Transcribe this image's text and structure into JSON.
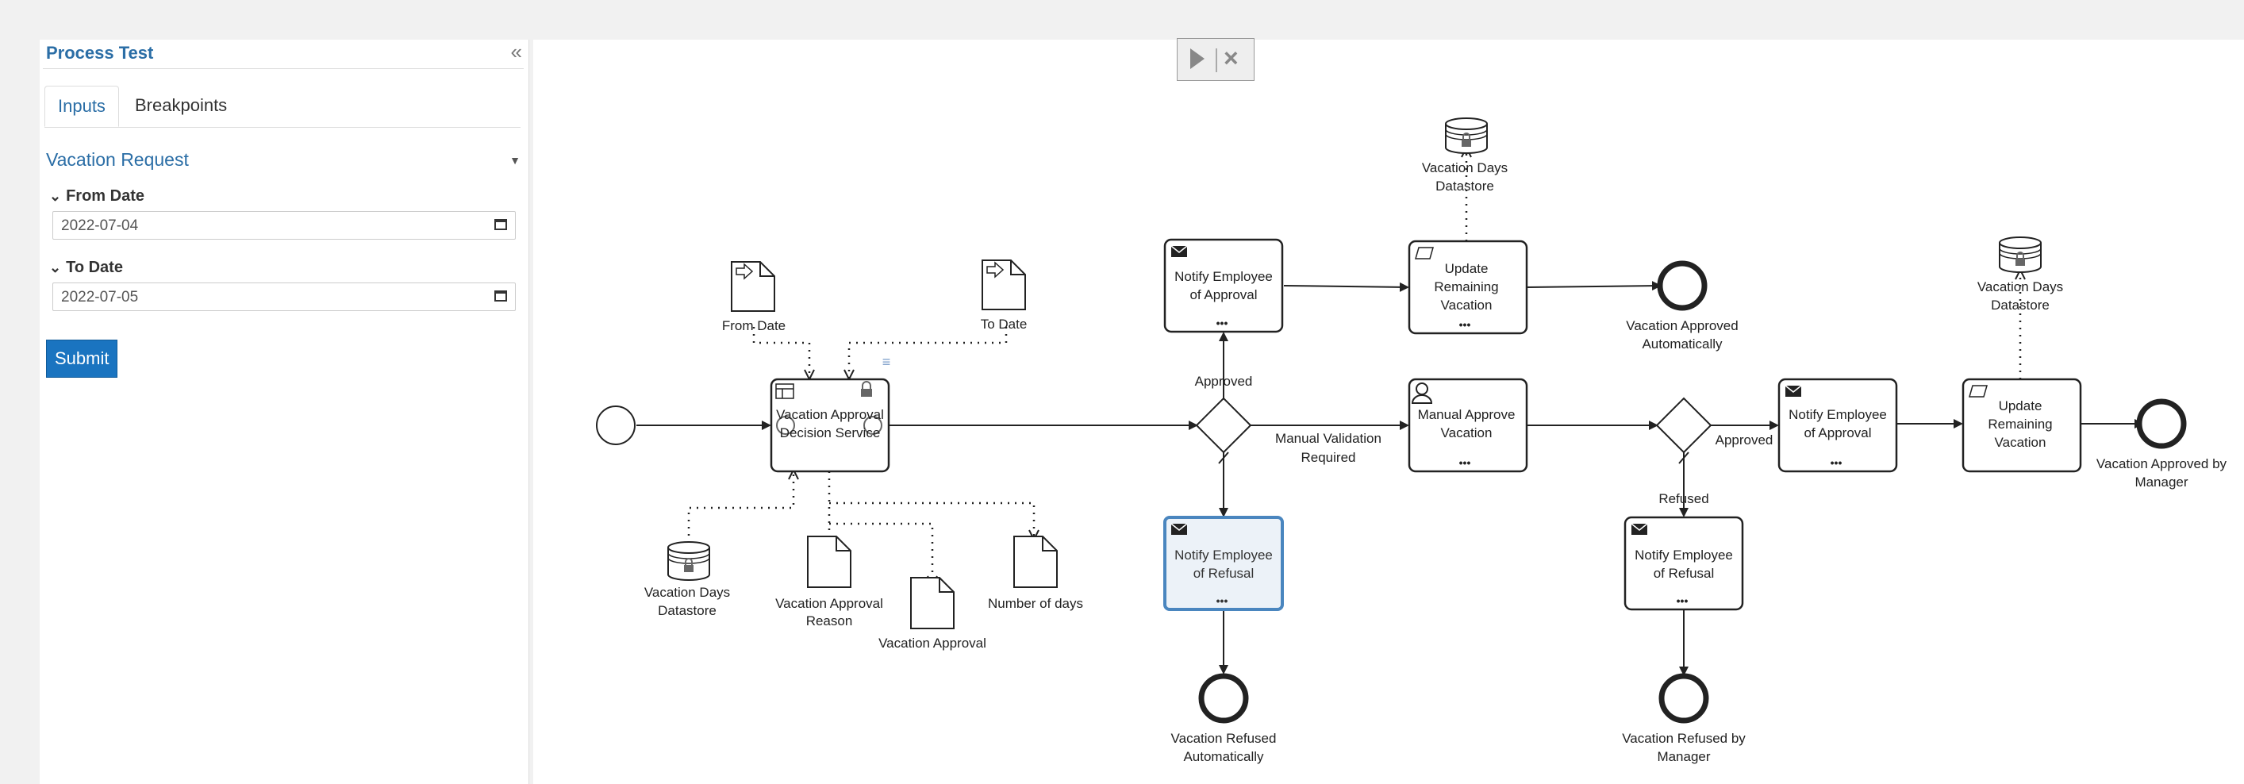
{
  "panel": {
    "title": "Process Test",
    "collapse_icon": "«",
    "tabs": [
      "Inputs",
      "Breakpoints"
    ],
    "section_title": "Vacation Request",
    "fields": [
      {
        "label": "From Date",
        "value": "2022-07-04"
      },
      {
        "label": "To Date",
        "value": "2022-07-05"
      }
    ],
    "submit_label": "Submit"
  },
  "toolbar": {
    "play_icon": "play-icon",
    "close_icon": "×"
  },
  "diagram": {
    "from_date": "From Date",
    "to_date": "To Date",
    "decision_line1": "Vacation Approval",
    "decision_line2": "Decision Service",
    "vds_line1": "Vacation Days",
    "vds_line2": "Datastore",
    "reason_line1": "Vacation Approval",
    "reason_line2": "Reason",
    "approval_doc": "Vacation Approval",
    "number_of_days": "Number of days",
    "notify_line1": "Notify Employee",
    "of_approval": "of Approval",
    "of_refusal": "of Refusal",
    "update_line1": "Update",
    "update_line2": "Remaining",
    "update_line3": "Vacation",
    "approved": "Approved",
    "manual_validation_line1": "Manual Validation",
    "manual_validation_line2": "Required",
    "manual_approve_line1": "Manual Approve",
    "manual_approve_line2": "Vacation",
    "refused": "Refused",
    "approved_auto_line1": "Vacation Approved",
    "approved_auto_line2": "Automatically",
    "refused_auto_line1": "Vacation Refused",
    "refused_auto_line2": "Automatically",
    "refused_mgr_line1": "Vacation Refused by",
    "refused_mgr_line2": "Manager",
    "approved_mgr_line1": "Vacation Approved by",
    "approved_mgr_line2": "Manager",
    "dots": "•••"
  }
}
